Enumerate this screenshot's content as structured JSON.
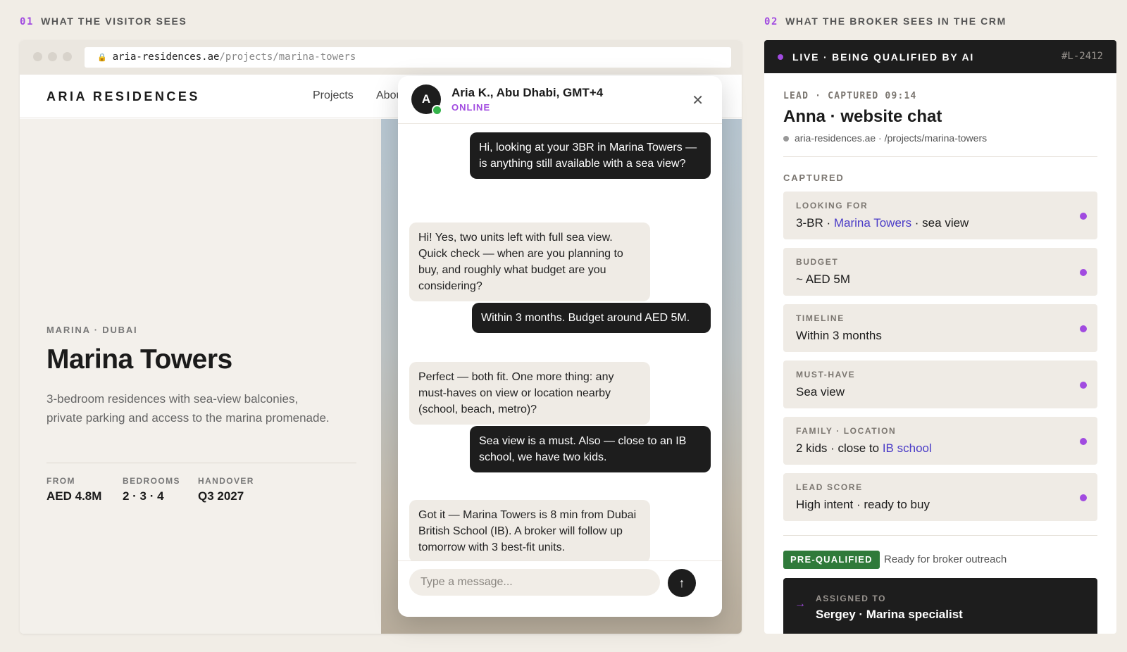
{
  "sections": {
    "visitor": {
      "num": "01",
      "label": "WHAT THE VISITOR SEES"
    },
    "broker": {
      "num": "02",
      "label": "WHAT THE BROKER SEES IN THE CRM"
    }
  },
  "browser": {
    "url_domain": "aria-residences.ae",
    "url_path": "/projects/marina-towers"
  },
  "site": {
    "brand": "ARIA RESIDENCES",
    "nav": [
      "Projects",
      "About"
    ],
    "location": "MARINA · DUBAI",
    "title": "Marina Towers",
    "description": "3-bedroom residences with sea-view balconies, private parking and access to the marina promenade.",
    "stats": [
      {
        "label": "FROM",
        "value": "AED 4.8M"
      },
      {
        "label": "BEDROOMS",
        "value": "2 · 3 · 4"
      },
      {
        "label": "HANDOVER",
        "value": "Q3 2027"
      }
    ]
  },
  "chat": {
    "avatar_initial": "A",
    "agent_name": "Aria K., Abu Dhabi, GMT+4",
    "status": "ONLINE",
    "messages": [
      {
        "from": "visitor",
        "text": "Hi, looking at your 3BR in Marina Towers — is anything still available with a sea view?"
      },
      {
        "from": "agent",
        "text": "Hi! Yes, two units left with full sea view. Quick check — when are you planning to buy, and roughly what budget are you considering?"
      },
      {
        "from": "visitor",
        "text": "Within 3 months. Budget around AED 5M."
      },
      {
        "from": "agent",
        "text": "Perfect — both fit. One more thing: any must-haves on view or location nearby (school, beach, metro)?"
      },
      {
        "from": "visitor",
        "text": "Sea view is a must. Also — close to an IB school, we have two kids."
      },
      {
        "from": "agent",
        "text": "Got it — Marina Towers is 8 min from Dubai British School (IB). A broker will follow up tomorrow with 3 best-fit units."
      }
    ],
    "input_placeholder": "Type a message..."
  },
  "crm": {
    "live_label": "LIVE · BEING QUALIFIED BY AI",
    "lead_id": "#L-2412",
    "lead_meta": "LEAD · CAPTURED 09:14",
    "lead_name": "Anna · website chat",
    "lead_source": "aria-residences.ae · /projects/marina-towers",
    "captured_header": "CAPTURED",
    "fields": [
      {
        "key": "LOOKING FOR",
        "pre": "3-BR · ",
        "hl": "Marina Towers",
        "post": " · sea view"
      },
      {
        "key": "BUDGET",
        "pre": "~ AED 5M",
        "hl": "",
        "post": ""
      },
      {
        "key": "TIMELINE",
        "pre": "Within 3 months",
        "hl": "",
        "post": ""
      },
      {
        "key": "MUST-HAVE",
        "pre": "Sea view",
        "hl": "",
        "post": ""
      },
      {
        "key": "FAMILY · LOCATION",
        "pre": "2 kids · close to ",
        "hl": "IB school",
        "post": ""
      },
      {
        "key": "LEAD SCORE",
        "pre": "High intent · ready to buy",
        "hl": "",
        "post": ""
      }
    ],
    "status_badge": "PRE-QUALIFIED",
    "status_note": "Ready for broker outreach",
    "assigned_label": "ASSIGNED TO",
    "assigned_value": "Sergey · Marina specialist"
  },
  "colors": {
    "accent": "#a14be0",
    "highlight": "#4a3bc7",
    "dark": "#1d1d1d",
    "success": "#2f7a3a",
    "background": "#f1ede6"
  },
  "icons": [
    "lock-icon",
    "close-icon",
    "send-arrow-icon",
    "arrow-right-icon",
    "online-dot-icon",
    "live-dot-icon"
  ]
}
